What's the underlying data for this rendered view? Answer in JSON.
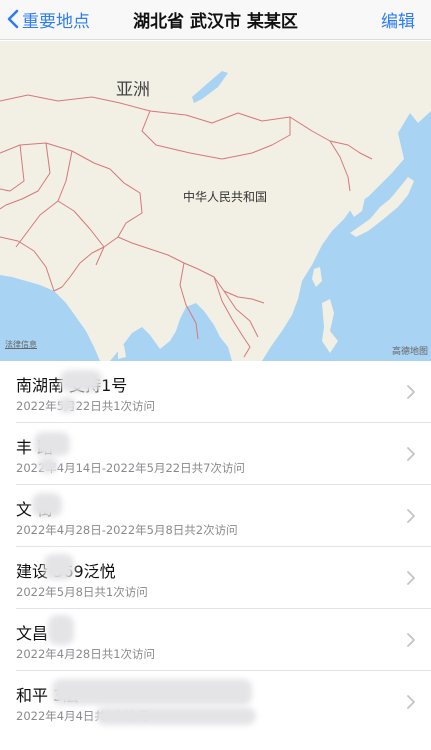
{
  "navbar": {
    "back_label": "重要地点",
    "title": "湖北省 武汉市 某某区",
    "edit_label": "编辑"
  },
  "map": {
    "continent_label": "亚洲",
    "country_label": "中华人民共和国",
    "legal_label": "法律信息",
    "provider_label": "高德地图",
    "colors": {
      "land": "#f2efe5",
      "water": "#a9d3f2",
      "border": "#d77878"
    }
  },
  "places": [
    {
      "title": "南湖南 支持1号",
      "subtitle": "2022年5月22日共1次访问"
    },
    {
      "title": "丰 路",
      "subtitle": "2022年4月14日-2022年5月22日共7次访问"
    },
    {
      "title": "文 街",
      "subtitle": "2022年4月28日-2022年5月8日共2次访问"
    },
    {
      "title": "建设 369泛悦",
      "subtitle": "2022年5月8日共1次访问"
    },
    {
      "title": "文昌",
      "subtitle": "2022年4月28日共1次访问"
    },
    {
      "title": "和平 3层",
      "subtitle": "2022年4月4日共1次访问"
    }
  ]
}
